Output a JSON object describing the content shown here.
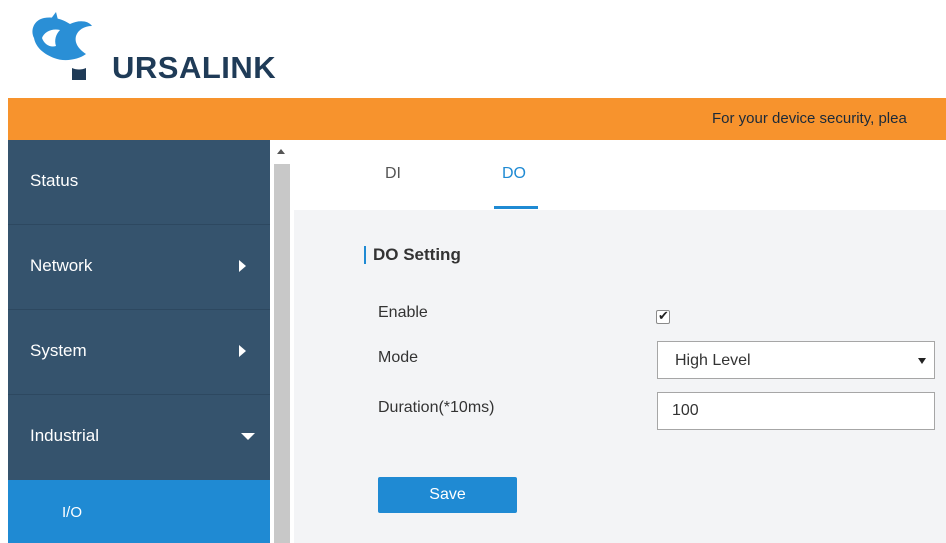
{
  "header": {
    "logo_text": "URSALINK",
    "brand_colors": {
      "primary": "#1f3b57",
      "accent": "#2a8fd6"
    }
  },
  "banner": {
    "text": "For your device security, plea",
    "color": "#f7932d"
  },
  "sidebar": {
    "items": [
      {
        "label": "Status",
        "icon": "none"
      },
      {
        "label": "Network",
        "icon": "chevron-right-icon"
      },
      {
        "label": "System",
        "icon": "chevron-right-icon"
      },
      {
        "label": "Industrial",
        "icon": "chevron-down-icon"
      }
    ],
    "sub_items": [
      {
        "label": "I/O",
        "active": true
      }
    ],
    "colors": {
      "background": "#35536d",
      "active": "#1f8ad3"
    }
  },
  "tabs": [
    {
      "label": "DI",
      "active": false
    },
    {
      "label": "DO",
      "active": true
    }
  ],
  "section": {
    "title": "DO Setting"
  },
  "form": {
    "enable": {
      "label": "Enable",
      "checked": true
    },
    "mode": {
      "label": "Mode",
      "value": "High Level"
    },
    "duration": {
      "label": "Duration(*10ms)",
      "value": "100"
    },
    "save_label": "Save"
  }
}
